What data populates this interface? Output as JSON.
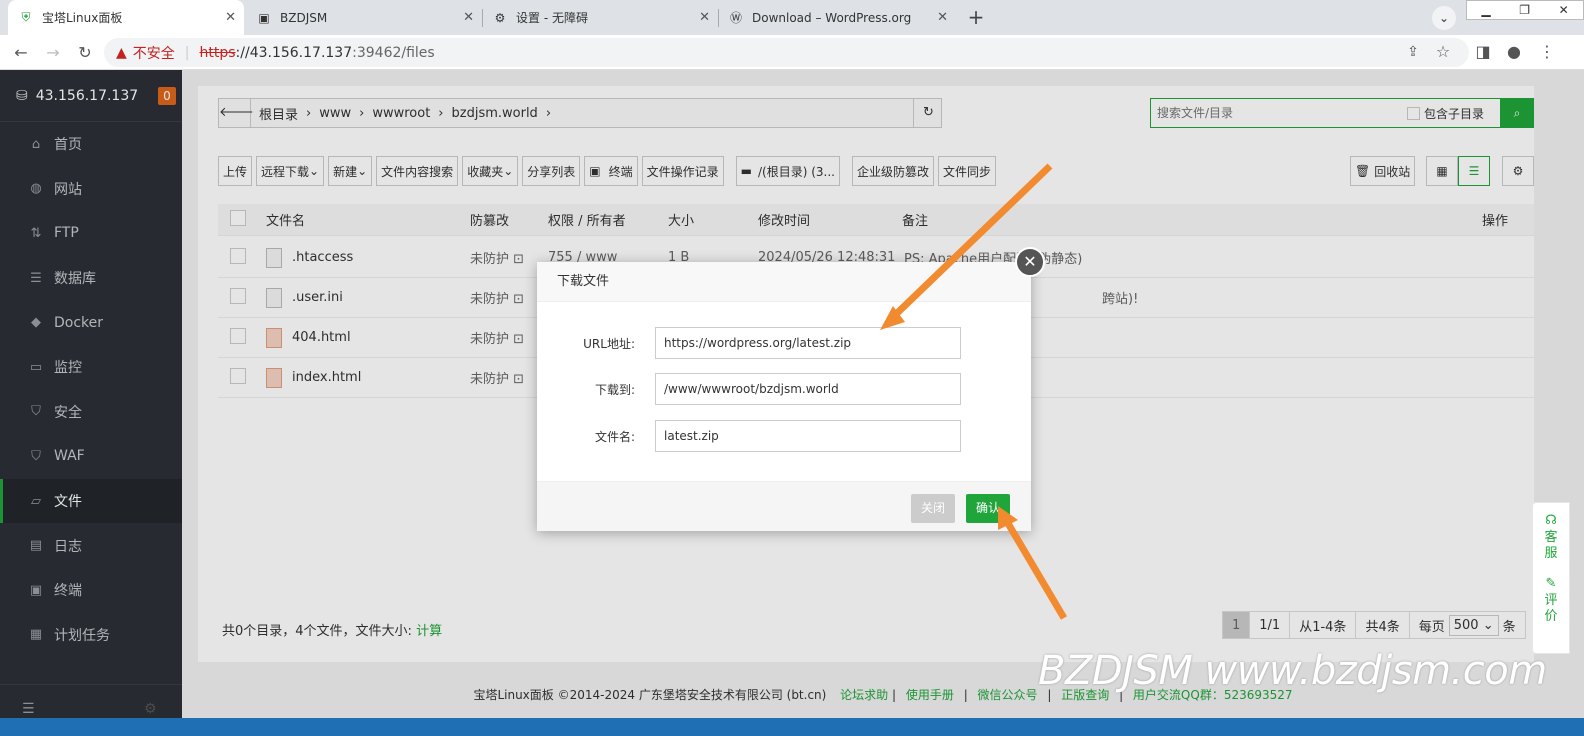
{
  "browser": {
    "tabs": [
      {
        "title": "宝塔Linux面板",
        "icon": "shield-icon",
        "active": true
      },
      {
        "title": "BZDJSM",
        "icon": "page-icon",
        "active": false
      },
      {
        "title": "设置 - 无障碍",
        "icon": "gear-icon",
        "active": false
      },
      {
        "title": "Download – WordPress.org",
        "icon": "wordpress-icon",
        "active": false
      }
    ],
    "insecure_label": "不安全",
    "url_scheme": "https",
    "url_host": "://43.156.17.137",
    "url_rest": ":39462/files"
  },
  "sidebar": {
    "server": "43.156.17.137",
    "badge": "0",
    "items": [
      {
        "label": "首页",
        "icon": "home-icon"
      },
      {
        "label": "网站",
        "icon": "globe-icon"
      },
      {
        "label": "FTP",
        "icon": "ftp-icon"
      },
      {
        "label": "数据库",
        "icon": "database-icon"
      },
      {
        "label": "Docker",
        "icon": "docker-icon"
      },
      {
        "label": "监控",
        "icon": "monitor-icon"
      },
      {
        "label": "安全",
        "icon": "shield-icon"
      },
      {
        "label": "WAF",
        "icon": "waf-icon"
      },
      {
        "label": "文件",
        "icon": "folder-icon",
        "active": true
      },
      {
        "label": "日志",
        "icon": "log-icon"
      },
      {
        "label": "终端",
        "icon": "terminal-icon"
      },
      {
        "label": "计划任务",
        "icon": "calendar-icon"
      }
    ]
  },
  "files": {
    "breadcrumb": [
      "根目录",
      "www",
      "wwwroot",
      "bzdjsm.world"
    ],
    "search_placeholder": "搜索文件/目录",
    "include_sub": "包含子目录",
    "toolbar": [
      "上传",
      "远程下载",
      "新建",
      "文件内容搜索",
      "收藏夹",
      "分享列表",
      "终端",
      "文件操作记录",
      "/(根目录) (3...",
      "企业级防篡改",
      "文件同步"
    ],
    "recycle": "回收站",
    "columns": {
      "name": "文件名",
      "protect": "防篡改",
      "perm": "权限 / 所有者",
      "size": "大小",
      "mtime": "修改时间",
      "note": "备注",
      "ops": "操作"
    },
    "rows": [
      {
        "name": ".htaccess",
        "protect": "未防护",
        "perm": "755 / www",
        "size": "1 B",
        "mtime": "2024/05/26 12:48:31",
        "note": "PS: Apache用户配置 (伪静态)",
        "type": "text"
      },
      {
        "name": ".user.ini",
        "protect": "未防护",
        "perm": "",
        "size": "",
        "mtime": "",
        "note": "跨站)!",
        "type": "text"
      },
      {
        "name": "404.html",
        "protect": "未防护",
        "perm": "",
        "size": "",
        "mtime": "",
        "note": "",
        "type": "html"
      },
      {
        "name": "index.html",
        "protect": "未防护",
        "perm": "",
        "size": "",
        "mtime": "",
        "note": "",
        "type": "html"
      }
    ],
    "summary": "共0个目录，4个文件，文件大小:",
    "calc": "计算",
    "pager": {
      "current": "1",
      "pages": "1/1",
      "range": "从1-4条",
      "total": "共4条",
      "per_page_label": "每页",
      "per_page": "500",
      "unit": "条"
    }
  },
  "copyright": {
    "text": "宝塔Linux面板 ©2014-2024 广东堡塔安全技术有限公司 (bt.cn)",
    "links": [
      "论坛求助",
      "使用手册",
      "微信公众号",
      "正版查询",
      "用户交流QQ群：523693527"
    ]
  },
  "dialog": {
    "title": "下载文件",
    "url_label": "URL地址:",
    "url_value": "https://wordpress.org/latest.zip",
    "dest_label": "下载到:",
    "dest_value": "/www/wwwroot/bzdjsm.world",
    "name_label": "文件名:",
    "name_value": "latest.zip",
    "cancel": "关闭",
    "confirm": "确认"
  },
  "float": {
    "service": "客服",
    "rate": "评价"
  },
  "watermark": "BZDJSM www.bzdjsm.com",
  "colors": {
    "accent": "#20a53a",
    "sidebar": "#2c3037",
    "arrow": "#f28a30"
  }
}
